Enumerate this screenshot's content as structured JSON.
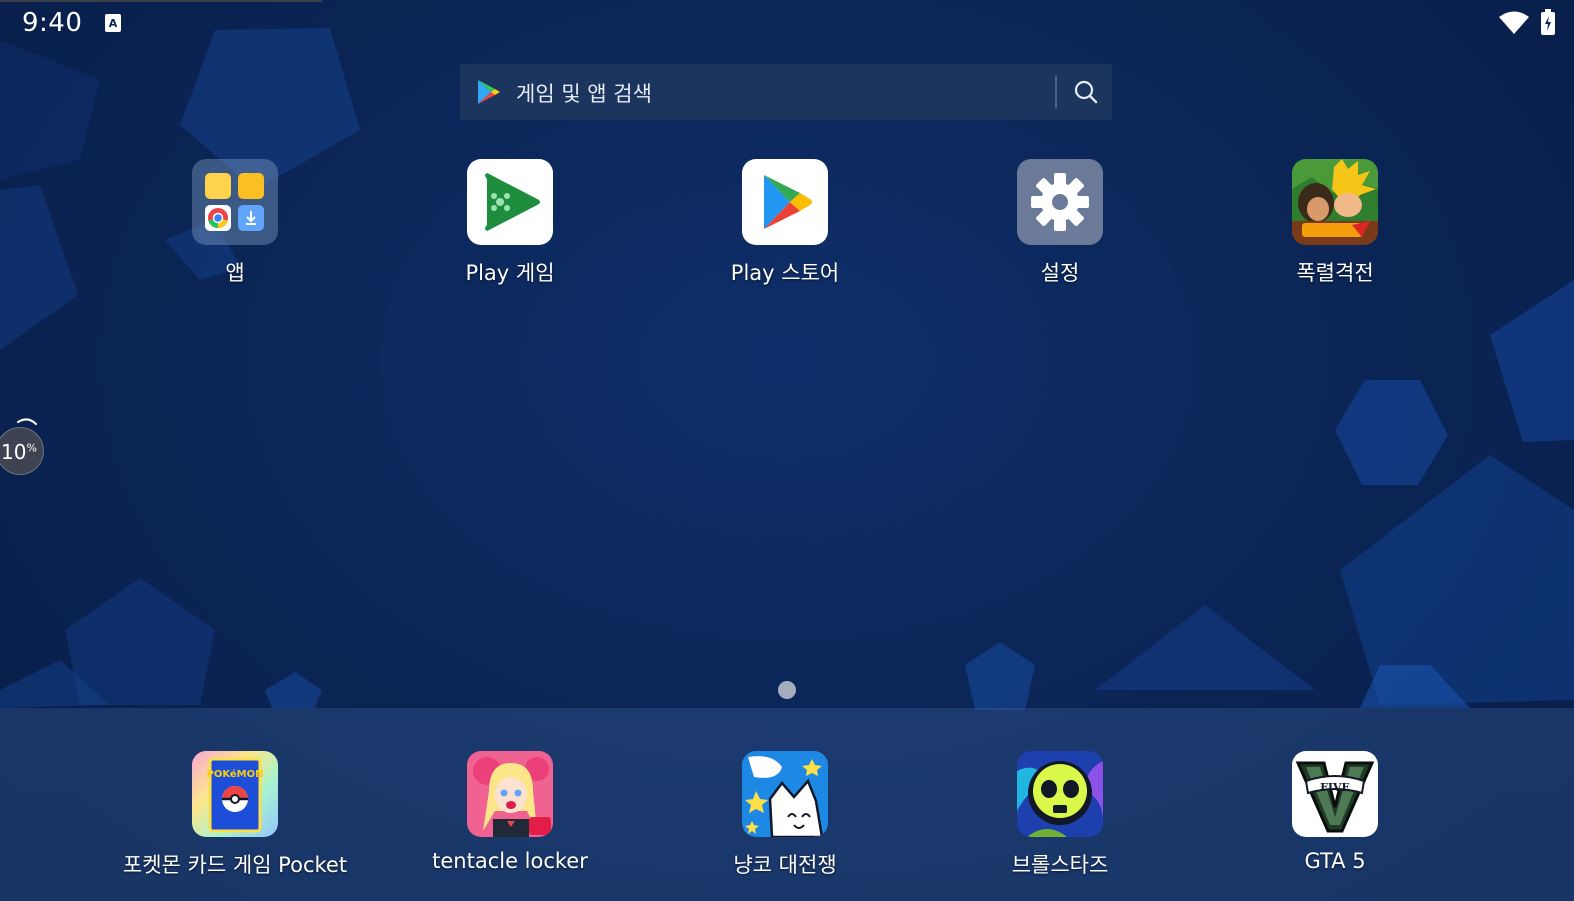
{
  "status_bar": {
    "time": "9:40",
    "icons": [
      "keyboard-icon",
      "wifi-icon",
      "battery-charging-icon"
    ]
  },
  "search": {
    "placeholder": "게임 및 앱 검색",
    "icons": [
      "google-play-icon",
      "search-icon"
    ]
  },
  "home_apps": [
    {
      "label": "앱",
      "icon": "app-folder-icon"
    },
    {
      "label": "Play 게임",
      "icon": "play-games-icon"
    },
    {
      "label": "Play 스토어",
      "icon": "play-store-icon"
    },
    {
      "label": "설정",
      "icon": "settings-gear-icon"
    },
    {
      "label": "폭렬격전",
      "icon": "dragon-ball-game-icon"
    }
  ],
  "progress_bubble": {
    "value": "10",
    "unit": "%"
  },
  "dock_apps": [
    {
      "label": "포켓몬 카드 게임 Pocket",
      "icon": "pokemon-card-icon"
    },
    {
      "label": "tentacle locker",
      "icon": "tentacle-locker-icon"
    },
    {
      "label": "냥코 대전쟁",
      "icon": "battle-cats-icon"
    },
    {
      "label": "브롤스타즈",
      "icon": "brawl-stars-icon"
    },
    {
      "label": "GTA 5",
      "icon": "gta-five-icon"
    }
  ],
  "colors": {
    "background": "#0b2658",
    "search_bar": "#1b355f",
    "settings_tile": "#6b7a99",
    "page_dot": "#a3adbd"
  }
}
